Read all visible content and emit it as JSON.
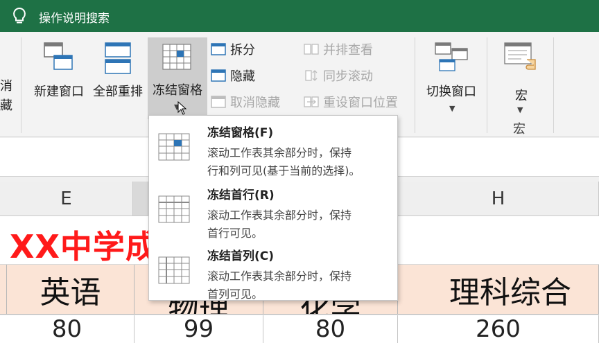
{
  "search": {
    "label": "操作说明搜索"
  },
  "ribbon": {
    "cut_left": [
      "消",
      "藏"
    ],
    "new_window": "新建窗口",
    "arrange_all": "全部重排",
    "freeze_panes": "冻结窗格",
    "split": "拆分",
    "hide": "隐藏",
    "unhide": "取消隐藏",
    "view_side_by_side": "并排查看",
    "sync_scroll": "同步滚动",
    "reset_position": "重设窗口位置",
    "switch_windows": "切换窗口",
    "macros": "宏",
    "macros_group": "宏"
  },
  "menu": {
    "items": [
      {
        "title": "冻结窗格(F)",
        "desc1": "滚动工作表其余部分时，保持",
        "desc2": "行和列可见(基于当前的选择)。"
      },
      {
        "title": "冻结首行(R)",
        "desc1": "滚动工作表其余部分时，保持",
        "desc2": "首行可见。"
      },
      {
        "title": "冻结首列(C)",
        "desc1": "滚动工作表其余部分时，保持",
        "desc2": "首列可见。"
      }
    ]
  },
  "sheet": {
    "col_headers": [
      "E",
      "H"
    ],
    "title": "XX中学成",
    "headers": [
      "英语",
      "物理",
      "化学",
      "理科综合"
    ],
    "values": [
      "80",
      "99",
      "80",
      "260"
    ]
  },
  "colors": {
    "excel_green": "#1e7145",
    "title_red": "#ff1a1a",
    "header_fill": "#fbe4d6",
    "active_button": "#cdcdcd"
  }
}
